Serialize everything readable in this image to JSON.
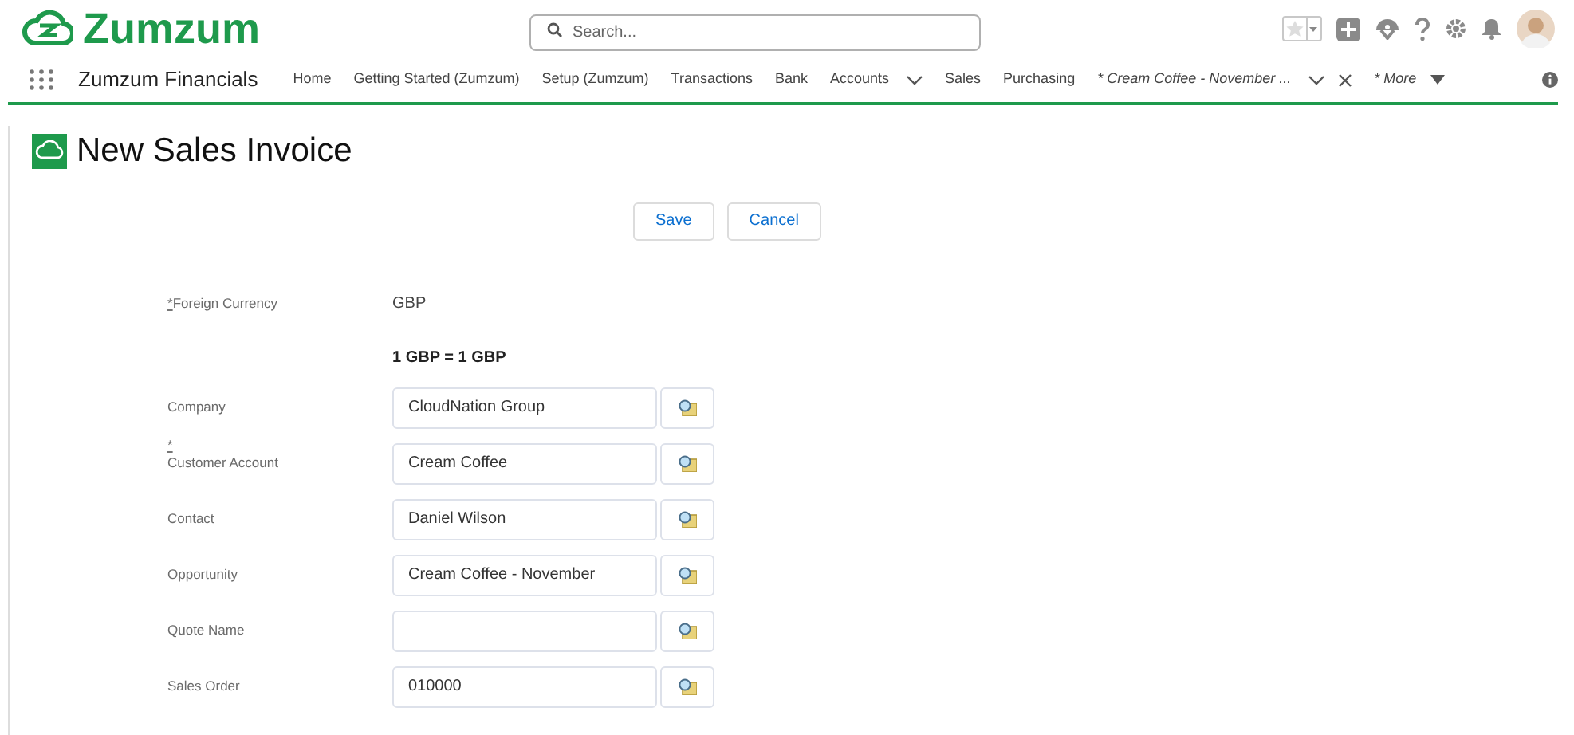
{
  "brand": {
    "name": "Zumzum"
  },
  "search": {
    "placeholder": "Search..."
  },
  "app_name": "Zumzum Financials",
  "nav": [
    {
      "label": "Home",
      "kind": "link"
    },
    {
      "label": "Getting Started (Zumzum)",
      "kind": "link"
    },
    {
      "label": "Setup (Zumzum)",
      "kind": "link"
    },
    {
      "label": "Transactions",
      "kind": "link"
    },
    {
      "label": "Bank",
      "kind": "link"
    },
    {
      "label": "Accounts",
      "kind": "menu"
    },
    {
      "label": "Sales",
      "kind": "link"
    },
    {
      "label": "Purchasing",
      "kind": "link"
    },
    {
      "label": "* Cream Coffee - November ...",
      "kind": "record_tab"
    },
    {
      "label": "* More",
      "kind": "more"
    }
  ],
  "page_title": "New Sales Invoice",
  "buttons": [
    "Save",
    "Cancel"
  ],
  "fields": [
    {
      "kind": "static",
      "label": "Foreign Currency",
      "required_mark": "*",
      "value": "GBP"
    },
    {
      "kind": "note",
      "value": "1 GBP = 1 GBP"
    },
    {
      "kind": "lookup",
      "label": "Company",
      "value": "CloudNation Group"
    },
    {
      "kind": "lookup",
      "label": "Customer Account",
      "required_mark": "*",
      "value": "Cream Coffee"
    },
    {
      "kind": "lookup",
      "label": "Contact",
      "value": "Daniel Wilson"
    },
    {
      "kind": "lookup",
      "label": "Opportunity",
      "value": "Cream Coffee - November"
    },
    {
      "kind": "lookup",
      "label": "Quote Name"
    },
    {
      "kind": "lookup",
      "label": "Sales Order",
      "value": "010000"
    }
  ]
}
